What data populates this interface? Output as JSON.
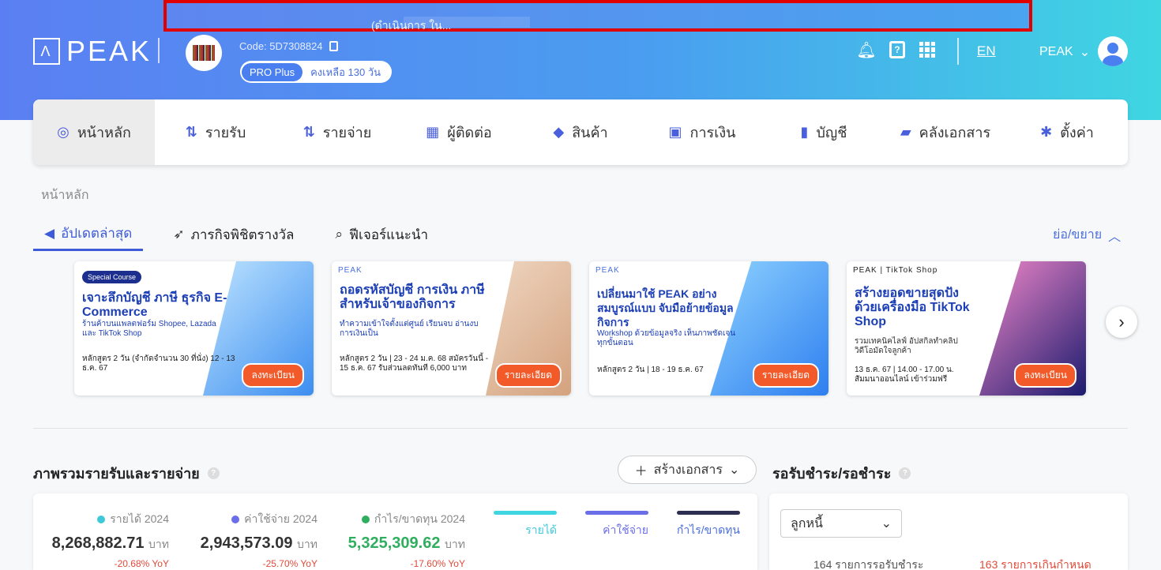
{
  "banner": {
    "text": "(ดำเนินการ ใน..."
  },
  "brand": {
    "logo_text": "PEAK",
    "logo_symbol": "Λ"
  },
  "company": {
    "code": "Code: 5D7308824",
    "avatar_caption": "BOOK OF LIFE"
  },
  "plan": {
    "name": "PRO Plus",
    "remaining": "คงเหลือ 130 วัน"
  },
  "header": {
    "language": "EN",
    "user_name": "PEAK"
  },
  "nav": [
    {
      "label": "หน้าหลัก",
      "icon": "home-gauge-icon",
      "glyph": "◎"
    },
    {
      "label": "รายรับ",
      "icon": "income-icon",
      "glyph": "⇅"
    },
    {
      "label": "รายจ่าย",
      "icon": "expense-icon",
      "glyph": "⇅"
    },
    {
      "label": "ผู้ติดต่อ",
      "icon": "contacts-icon",
      "glyph": "▦"
    },
    {
      "label": "สินค้า",
      "icon": "product-box-icon",
      "glyph": "◆"
    },
    {
      "label": "การเงิน",
      "icon": "money-icon",
      "glyph": "▣"
    },
    {
      "label": "บัญชี",
      "icon": "ledger-icon",
      "glyph": "▮"
    },
    {
      "label": "คลังเอกสาร",
      "icon": "folder-icon",
      "glyph": "▰"
    },
    {
      "label": "ตั้งค่า",
      "icon": "gear-icon",
      "glyph": "✱"
    }
  ],
  "breadcrumb": "หน้าหลัก",
  "tabs": [
    {
      "label": "อัปเดตล่าสุด",
      "icon": "megaphone-icon",
      "glyph": "◀"
    },
    {
      "label": "ภารกิจพิชิตรางวัล",
      "icon": "rocket-icon",
      "glyph": "➶"
    },
    {
      "label": "ฟีเจอร์แนะนำ",
      "icon": "search-icon",
      "glyph": "⌕"
    }
  ],
  "collapse_label": "ย่อ/ขยาย",
  "promos": [
    {
      "badge": "Special Course",
      "title": "เจาะลึกบัญชี ภาษี ธุรกิจ E-Commerce",
      "subtitle": "ร้านค้าบนแพลตฟอร์ม Shopee, Lazada และ TikTok Shop",
      "details": "หลักสูตร 2 วัน (จำกัดจำนวน 30 ที่นั่ง) 12 - 13 ธ.ค. 67",
      "button": "ลงทะเบียน"
    },
    {
      "badge": "PEAK",
      "title": "ถอดรหัสบัญชี การเงิน ภาษี สำหรับเจ้าของกิจการ",
      "subtitle": "ทำความเข้าใจตั้งแต่ศูนย์ เรียนจบ อ่านงบการเงินเป็น",
      "details": "หลักสูตร 2 วัน | 23 - 24 ม.ค. 68 สมัครวันนี้ - 15 ธ.ค. 67 รับส่วนลดทันที 6,000 บาท",
      "button": "รายละเอียด"
    },
    {
      "badge": "PEAK",
      "title": "เปลี่ยนมาใช้ PEAK อย่างสมบูรณ์แบบ จับมือย้ายข้อมูลกิจการ",
      "subtitle": "Workshop ด้วยข้อมูลจริง เห็นภาพชัดเจนทุกขั้นตอน",
      "details": "หลักสูตร 2 วัน | 18 - 19 ธ.ค. 67",
      "button": "รายละเอียด"
    },
    {
      "badge": "PEAK | TikTok Shop",
      "title": "สร้างยอดขายสุดปัง ด้วยเครื่องมือ TikTok Shop",
      "subtitle": "รวมเทคนิคไลฟ์ อัปสกิลทำคลิปวิดีโอมัดใจลูกค้า",
      "details": "13 ธ.ค. 67 | 14.00 - 17.00 น. สัมมนาออนไลน์ เข้าร่วมฟรี",
      "button": "ลงทะเบียน"
    }
  ],
  "overview": {
    "title": "ภาพรวมรายรับและรายจ่าย",
    "create_doc": "สร้างเอกสาร",
    "stats": [
      {
        "label": "รายได้ 2024",
        "value": "8,268,882.71",
        "unit": "บาท",
        "yoy": "-20.68% YoY",
        "color": "#3fc8d8",
        "value_color": "#222"
      },
      {
        "label": "ค่าใช้จ่าย 2024",
        "value": "2,943,573.09",
        "unit": "บาท",
        "yoy": "-25.70% YoY",
        "color": "#6a6ee8",
        "value_color": "#222"
      },
      {
        "label": "กำไร/ขาดทุน 2024",
        "value": "5,325,309.62",
        "unit": "บาท",
        "yoy": "-17.60% YoY",
        "color": "#2fae5f",
        "value_color": "#2fae5f"
      }
    ],
    "legend": [
      {
        "label": "รายได้",
        "color": "#3fd6e2"
      },
      {
        "label": "ค่าใช้จ่าย",
        "color": "#6a6ee8"
      },
      {
        "label": "กำไร/ขาดทุน",
        "color": "#2c2f52"
      }
    ]
  },
  "receivables": {
    "title": "รอรับชำระ/รอชำระ",
    "select_value": "ลูกหนี้",
    "pending": "164 รายการรอรับชำระ",
    "overdue": "163 รายการเกินกำหนด"
  }
}
